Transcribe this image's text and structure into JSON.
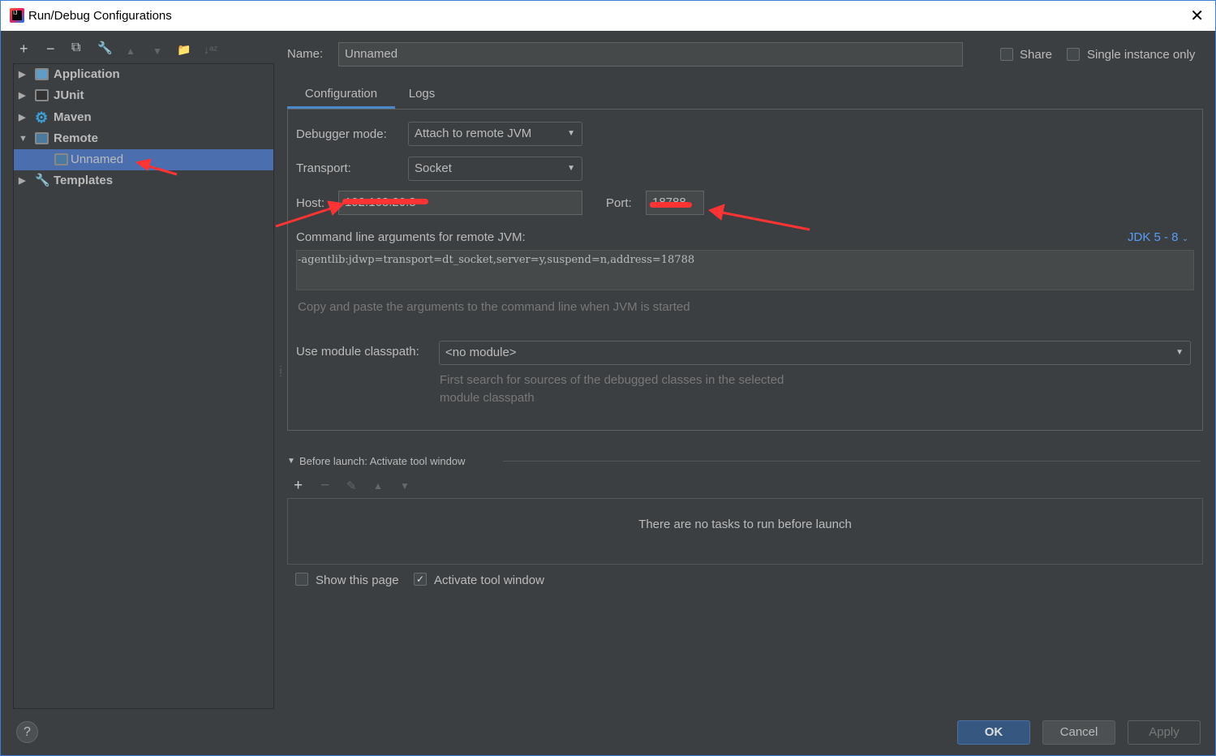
{
  "window": {
    "title": "Run/Debug Configurations"
  },
  "toolbar": {
    "add": "+",
    "remove": "−",
    "copy": "⧉",
    "edit": "🔧",
    "up": "▲",
    "down": "▼",
    "folder": "📁",
    "sort": "↓ᵃᶻ"
  },
  "tree": [
    {
      "label": "Application",
      "expanded": false
    },
    {
      "label": "JUnit",
      "expanded": false
    },
    {
      "label": "Maven",
      "expanded": false
    },
    {
      "label": "Remote",
      "expanded": true
    },
    {
      "label": "Unnamed",
      "selected": true
    },
    {
      "label": "Templates",
      "expanded": false
    }
  ],
  "name": {
    "label": "Name:",
    "value": "Unnamed"
  },
  "share": {
    "label": "Share",
    "checked": false
  },
  "single": {
    "label": "Single instance only",
    "checked": false
  },
  "tabs": [
    {
      "label": "Configuration",
      "active": true
    },
    {
      "label": "Logs"
    }
  ],
  "config": {
    "debugger_mode_label": "Debugger mode:",
    "debugger_mode": "Attach to remote JVM",
    "transport_label": "Transport:",
    "transport": "Socket",
    "host_label": "Host:",
    "host": "192.168.20.8",
    "port_label": "Port:",
    "port": "18788",
    "cmd_label": "Command line arguments for remote JVM:",
    "jdk": "JDK 5 - 8",
    "cmd": "-agentlib:jdwp=transport=dt_socket,server=y,suspend=n,address=18788",
    "cmd_hint": "Copy and paste the arguments to the command line when JVM is started",
    "module_label": "Use module classpath:",
    "module": "<no module>",
    "module_hint1": "First search for sources of the debugged classes in the selected",
    "module_hint2": "module classpath"
  },
  "before_launch": {
    "title": "Before launch: Activate tool window",
    "empty": "There are no tasks to run before launch"
  },
  "show_page": {
    "label": "Show this page",
    "checked": false
  },
  "activate": {
    "label": "Activate tool window",
    "checked": true
  },
  "buttons": {
    "ok": "OK",
    "cancel": "Cancel",
    "apply": "Apply",
    "help": "?"
  },
  "colors": {
    "accent": "#365880",
    "selection": "#4b6eaf",
    "link": "#589df6",
    "annotation": "#ff3333"
  }
}
